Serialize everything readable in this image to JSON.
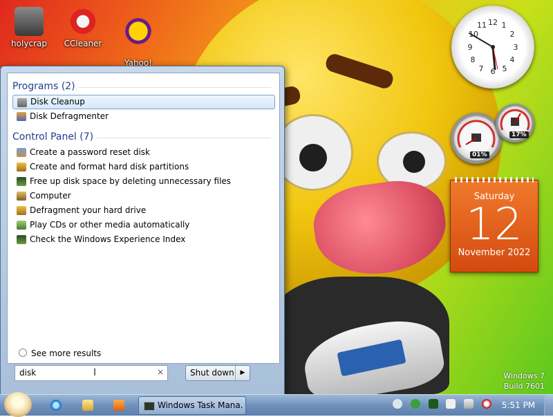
{
  "desktop": {
    "icons": [
      {
        "label": "holycrap",
        "icon": "folder-icon"
      },
      {
        "label": "CCleaner",
        "icon": "ccleaner-icon"
      },
      {
        "label": "Yahoo!\nMessenger",
        "icon": "yahoo-messenger-icon"
      }
    ],
    "os_version": {
      "line1": "Windows 7",
      "line2": "Build 7601"
    }
  },
  "gadgets": {
    "meter_cpu": "01%",
    "meter_mem": "17%",
    "calendar": {
      "day": "Saturday",
      "date": "12",
      "month_year": "November 2022"
    }
  },
  "start_menu": {
    "programs_header": "Programs (2)",
    "programs": [
      {
        "label": "Disk Cleanup",
        "selected": true
      },
      {
        "label": "Disk Defragmenter",
        "selected": false
      }
    ],
    "control_panel_header": "Control Panel (7)",
    "control_panel": [
      {
        "label": "Create a password reset disk"
      },
      {
        "label": "Create and format hard disk partitions"
      },
      {
        "label": "Free up disk space by deleting unnecessary files"
      },
      {
        "label": "Computer"
      },
      {
        "label": "Defragment your hard drive"
      },
      {
        "label": "Play CDs or other media automatically"
      },
      {
        "label": "Check the Windows Experience Index"
      }
    ],
    "see_more": "See more results",
    "search_value": "disk",
    "clear_glyph": "×",
    "shutdown_label": "Shut down",
    "shutdown_arrow": "▶"
  },
  "taskbar": {
    "task_label": "Windows Task Mana...",
    "time": "5:51 PM"
  },
  "colors": {
    "accent": "#1e3f8c",
    "taskbar": "#6f92bc",
    "calendar": "#e0601c"
  }
}
